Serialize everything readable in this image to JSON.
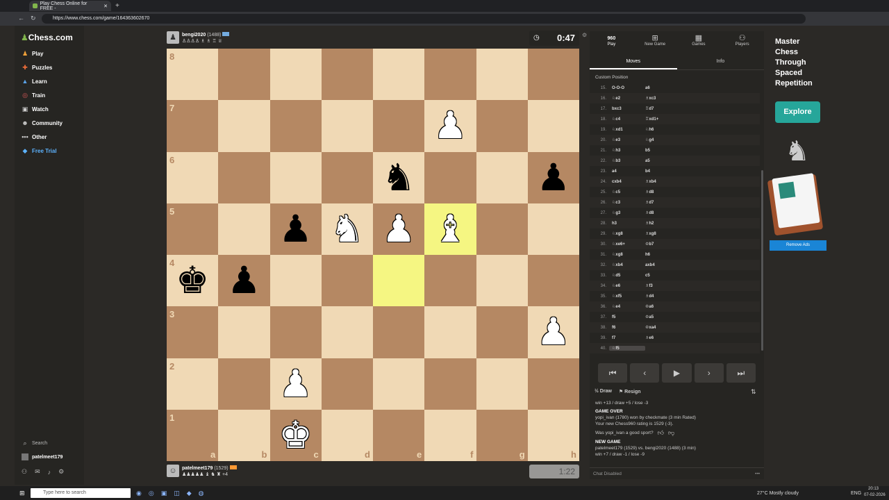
{
  "browser": {
    "tab_title": "Play Chess Online for FREE -",
    "url": "https://www.chess.com/game/164363602670"
  },
  "sidebar": {
    "logo": "Chess.com",
    "items": [
      {
        "label": "Play",
        "icon": "pawn-icon"
      },
      {
        "label": "Puzzles",
        "icon": "puzzle-icon"
      },
      {
        "label": "Learn",
        "icon": "learn-icon"
      },
      {
        "label": "Train",
        "icon": "train-icon"
      },
      {
        "label": "Watch",
        "icon": "watch-icon"
      },
      {
        "label": "Community",
        "icon": "community-icon"
      },
      {
        "label": "Other",
        "icon": "ellipsis-icon"
      },
      {
        "label": "Free Trial",
        "icon": "diamond-icon"
      }
    ],
    "search_label": "Search",
    "username": "patelmeet179"
  },
  "top_player": {
    "name": "bengi2020",
    "rating": "(1488)",
    "captured": "♙♙♙♙ ♗ ♗ ♖ ♕"
  },
  "bottom_player": {
    "name": "patelmeet179",
    "rating": "(1529)",
    "captured": "♟♟♟♟♟ ♝ ♞ ♜ +4"
  },
  "clocks": {
    "top": "0:47",
    "bottom": "1:22"
  },
  "board": {
    "ranks": [
      "8",
      "7",
      "6",
      "5",
      "4",
      "3",
      "2",
      "1"
    ],
    "files": [
      "a",
      "b",
      "c",
      "d",
      "e",
      "f",
      "g",
      "h"
    ],
    "pieces": {
      "f7": "wP",
      "e6": "bN",
      "h6": "bP",
      "c5": "bP",
      "d5": "wN",
      "e5": "wP",
      "f5": "wB",
      "a4": "bK",
      "b4": "bP",
      "h3": "wP",
      "c2": "wP",
      "c1": "wK"
    },
    "highlights": [
      "f5",
      "e4"
    ]
  },
  "panel": {
    "tabs": [
      {
        "label": "Play",
        "icon": "960"
      },
      {
        "label": "New Game",
        "icon": "plus-icon"
      },
      {
        "label": "Games",
        "icon": "games-icon"
      },
      {
        "label": "Players",
        "icon": "players-icon"
      }
    ],
    "subtabs": [
      "Moves",
      "Info"
    ],
    "custom_position": "Custom Position",
    "moves": [
      {
        "n": "15.",
        "w": "O-O-O",
        "b": "a6"
      },
      {
        "n": "16.",
        "w": "♘e2",
        "b": "♗xc3"
      },
      {
        "n": "17.",
        "w": "bxc3",
        "b": "♖d7"
      },
      {
        "n": "18.",
        "w": "♘c4",
        "b": "♖xd1+"
      },
      {
        "n": "19.",
        "w": "♘xd1",
        "b": "♘h6"
      },
      {
        "n": "20.",
        "w": "♘e3",
        "b": "♘g4"
      },
      {
        "n": "21.",
        "w": "♘h3",
        "b": "b5"
      },
      {
        "n": "22.",
        "w": "♘b3",
        "b": "a5"
      },
      {
        "n": "23.",
        "w": "a4",
        "b": "b4"
      },
      {
        "n": "24.",
        "w": "cxb4",
        "b": "♗xb4"
      },
      {
        "n": "25.",
        "w": "♘c5",
        "b": "♗d8"
      },
      {
        "n": "26.",
        "w": "♘c3",
        "b": "♗d7"
      },
      {
        "n": "27.",
        "w": "♘g3",
        "b": "♗d8"
      },
      {
        "n": "28.",
        "w": "h3",
        "b": "♗h2"
      },
      {
        "n": "29.",
        "w": "♘xg8",
        "b": "♗xg8"
      },
      {
        "n": "30.",
        "w": "♘xe6+",
        "b": "♔b7"
      },
      {
        "n": "31.",
        "w": "♘xg8",
        "b": "h6"
      },
      {
        "n": "32.",
        "w": "♘xb4",
        "b": "axb4"
      },
      {
        "n": "33.",
        "w": "♘d5",
        "b": "c5"
      },
      {
        "n": "34.",
        "w": "♘e6",
        "b": "♗f3"
      },
      {
        "n": "35.",
        "w": "♘xf5",
        "b": "♗d4"
      },
      {
        "n": "36.",
        "w": "♘e4",
        "b": "♔a6"
      },
      {
        "n": "37.",
        "w": "f5",
        "b": "♔a5"
      },
      {
        "n": "38.",
        "w": "f6",
        "b": "♔xa4"
      },
      {
        "n": "39.",
        "w": "f7",
        "b": "♗e6"
      },
      {
        "n": "40.",
        "w": "♘f5",
        "b": ""
      }
    ],
    "controls": [
      "⏮",
      "‹",
      "▶",
      "›",
      "⏭"
    ],
    "draw": "Draw",
    "resign": "Resign",
    "chat": {
      "line1": "win +13 / draw +5 / lose -3",
      "game_over": "GAME OVER",
      "result": "yopi_ivan (1780) won by checkmate (3 min Rated)",
      "new_rating": "Your new Chess960 rating is 1529 (-3).",
      "sport": "Was yopi_ivan a good sport?",
      "new_game": "NEW GAME",
      "new_game_players": "patelmeet179 (1529) vs. bengi2020 (1488) (3 min)",
      "new_game_odds": "win +7 / draw -1 / lose -9"
    },
    "chat_disabled": "Chat Disabled"
  },
  "ad": {
    "title": "Master Chess Through Spaced Repetition",
    "button": "Explore",
    "remove": "Remove Ads"
  },
  "taskbar": {
    "search": "Type here to search",
    "weather": "27°C  Mostly cloudy",
    "lang": "ENG",
    "time": "20:13",
    "date": "07-02-2026"
  }
}
